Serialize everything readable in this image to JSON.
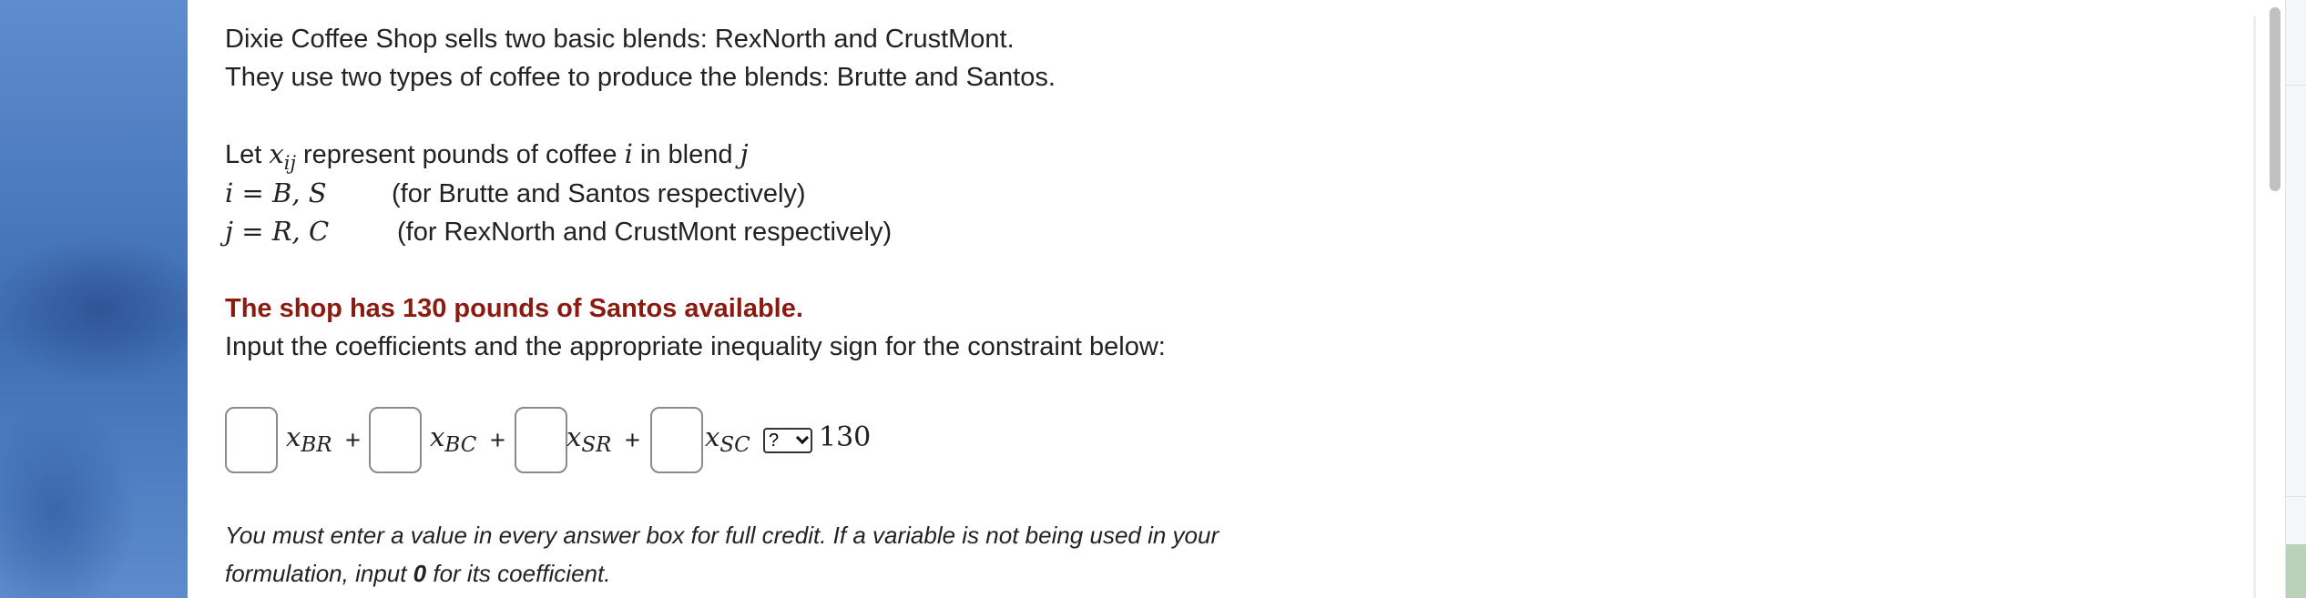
{
  "problem": {
    "intro_line1": "Dixie Coffee Shop sells two basic blends: RexNorth and CrustMont.",
    "intro_line2": "They use two types of coffee to produce the blends: Brutte and Santos.",
    "let_prefix": "Let ",
    "let_var": "x",
    "let_var_sub": "ij",
    "let_mid": " represent pounds of coffee ",
    "let_i": "i",
    "let_mid2": " in blend ",
    "let_j": "j",
    "i_def_math": "i = B, S",
    "i_def_text": "(for Brutte and Santos respectively)",
    "j_def_math": "j = R, C",
    "j_def_text": "(for RexNorth and CrustMont respectively)",
    "constraint_statement": "The shop has 130 pounds of Santos available.",
    "instruction": "Input the coefficients and the appropriate inequality sign for the constraint below:"
  },
  "constraint": {
    "terms": [
      {
        "var": "x",
        "sub": "BR",
        "value": "",
        "placeholder": ""
      },
      {
        "var": "x",
        "sub": "BC",
        "value": "",
        "placeholder": ""
      },
      {
        "var": "x",
        "sub": "SR",
        "value": "",
        "placeholder": ""
      },
      {
        "var": "x",
        "sub": "SC",
        "value": "",
        "placeholder": ""
      }
    ],
    "plus": "+",
    "inequality_selected": "?",
    "rhs": "130"
  },
  "note": {
    "line1": "You must enter a value in every answer box for full credit. If a variable is not being used in your",
    "line2_prefix": "formulation, input ",
    "line2_bold": "0",
    "line2_suffix": " for its coefficient."
  },
  "colors": {
    "emphasis_red": "#8b1a10",
    "text": "#222222",
    "sidebar_blue": "#4b79be"
  }
}
